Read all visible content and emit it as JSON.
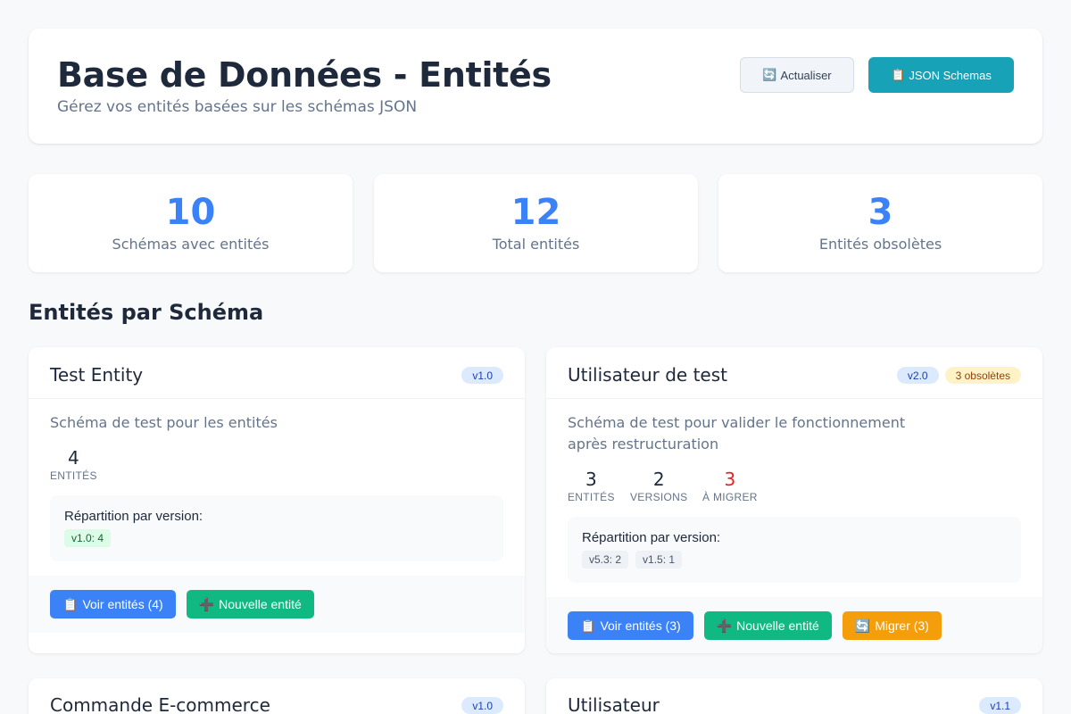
{
  "header": {
    "title": "Base de Données - Entités",
    "subtitle": "Gérez vos entités basées sur les schémas JSON",
    "refresh_icon": "🔄",
    "refresh_label": "Actualiser",
    "schemas_icon": "📋",
    "schemas_label": "JSON Schemas"
  },
  "stats": [
    {
      "value": "10",
      "label": "Schémas avec entités"
    },
    {
      "value": "12",
      "label": "Total entités"
    },
    {
      "value": "3",
      "label": "Entités obsolètes"
    }
  ],
  "section_title": "Entités par Schéma",
  "cards": [
    {
      "title": "Test Entity",
      "version": "v1.0",
      "description": "Schéma de test pour les entités",
      "metrics": [
        {
          "value": "4",
          "label": "Entités"
        }
      ],
      "distribution_title": "Répartition par version:",
      "chips": [
        "v1.0: 4"
      ],
      "actions": [
        {
          "icon": "📋",
          "label": "Voir entités (4)"
        },
        {
          "icon": "➕",
          "label": "Nouvelle entité"
        }
      ]
    },
    {
      "title": "Utilisateur de test",
      "version": "v2.0",
      "obsolete_badge": "3 obsolètes",
      "description": "Schéma de test pour valider le fonctionnement après restructuration",
      "metrics": [
        {
          "value": "3",
          "label": "Entités"
        },
        {
          "value": "2",
          "label": "Versions"
        },
        {
          "value": "3",
          "label": "À migrer"
        }
      ],
      "distribution_title": "Répartition par version:",
      "chips": [
        "v5.3: 2",
        "v1.5: 1"
      ],
      "actions": [
        {
          "icon": "📋",
          "label": "Voir entités (3)"
        },
        {
          "icon": "➕",
          "label": "Nouvelle entité"
        },
        {
          "icon": "🔄",
          "label": "Migrer (3)"
        }
      ]
    },
    {
      "title": "Commande E-commerce",
      "version": "v1.0"
    },
    {
      "title": "Utilisateur",
      "version": "v1.1"
    }
  ],
  "colors": {
    "accent_blue": "#3b82f6",
    "accent_green": "#10b981",
    "accent_orange": "#f59e0b",
    "accent_teal": "#17a2b8",
    "warning_red": "#dc2626"
  }
}
